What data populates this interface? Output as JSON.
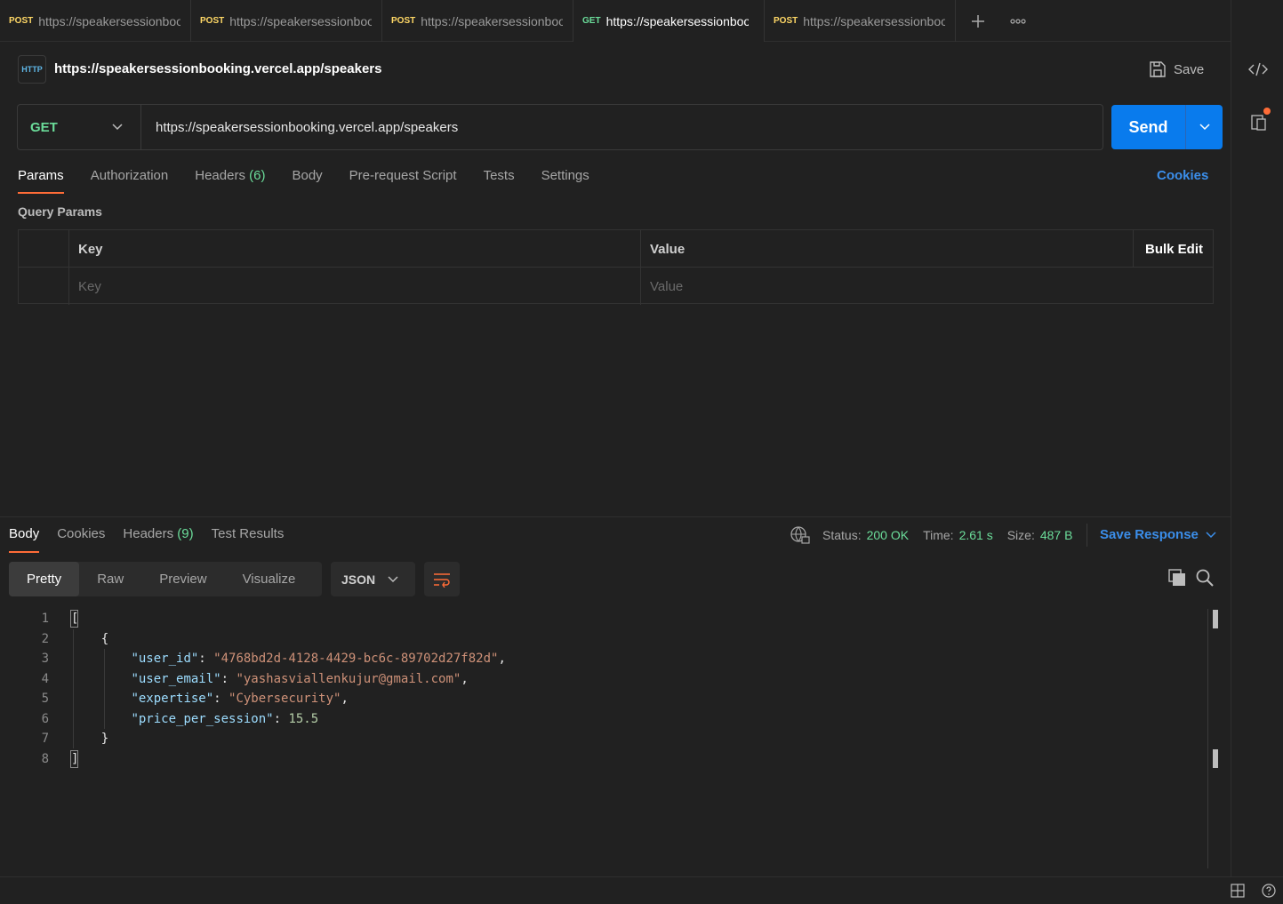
{
  "tabs": [
    {
      "method": "POST",
      "url": "https://speakersessionbooking.vercel.app",
      "active": false
    },
    {
      "method": "POST",
      "url": "https://speakersessionbooking.vercel.app",
      "active": false
    },
    {
      "method": "POST",
      "url": "https://speakersessionbooking.vercel.app",
      "active": false
    },
    {
      "method": "GET",
      "url": "https://speakersessionbooking.vercel.app",
      "active": true
    },
    {
      "method": "POST",
      "url": "https://speakersessionbooking.vercel.app",
      "active": false
    }
  ],
  "request": {
    "icon_text": "HTTP",
    "title": "https://speakersessionbooking.vercel.app/speakers",
    "save_label": "Save",
    "method": "GET",
    "url": "https://speakersessionbooking.vercel.app/speakers",
    "send_label": "Send"
  },
  "request_tabs": {
    "params": "Params",
    "authorization": "Authorization",
    "headers": "Headers",
    "headers_count": "(6)",
    "body": "Body",
    "prerequest": "Pre-request Script",
    "tests": "Tests",
    "settings": "Settings",
    "cookies": "Cookies"
  },
  "query_params": {
    "label": "Query Params",
    "key_header": "Key",
    "value_header": "Value",
    "bulk_edit": "Bulk Edit",
    "key_placeholder": "Key",
    "value_placeholder": "Value"
  },
  "response": {
    "tabs": {
      "body": "Body",
      "cookies": "Cookies",
      "headers": "Headers",
      "headers_count": "(9)",
      "test_results": "Test Results"
    },
    "status_label": "Status:",
    "status_value": "200 OK",
    "time_label": "Time:",
    "time_value": "2.61 s",
    "size_label": "Size:",
    "size_value": "487 B",
    "save_response": "Save Response",
    "view_modes": {
      "pretty": "Pretty",
      "raw": "Raw",
      "preview": "Preview",
      "visualize": "Visualize"
    },
    "format": "JSON",
    "line_numbers": [
      "1",
      "2",
      "3",
      "4",
      "5",
      "6",
      "7",
      "8"
    ],
    "json": {
      "k1": "\"user_id\"",
      "v1": "\"4768bd2d-4128-4429-bc6c-89702d27f82d\"",
      "k2": "\"user_email\"",
      "v2": "\"yashasviallenkujur@gmail.com\"",
      "k3": "\"expertise\"",
      "v3": "\"Cybersecurity\"",
      "k4": "\"price_per_session\"",
      "v4": "15.5"
    }
  },
  "colors": {
    "accent_orange": "#ff6c37",
    "send_blue": "#097bed",
    "get_green": "#6bdd9a",
    "post_yellow": "#ffd866"
  }
}
